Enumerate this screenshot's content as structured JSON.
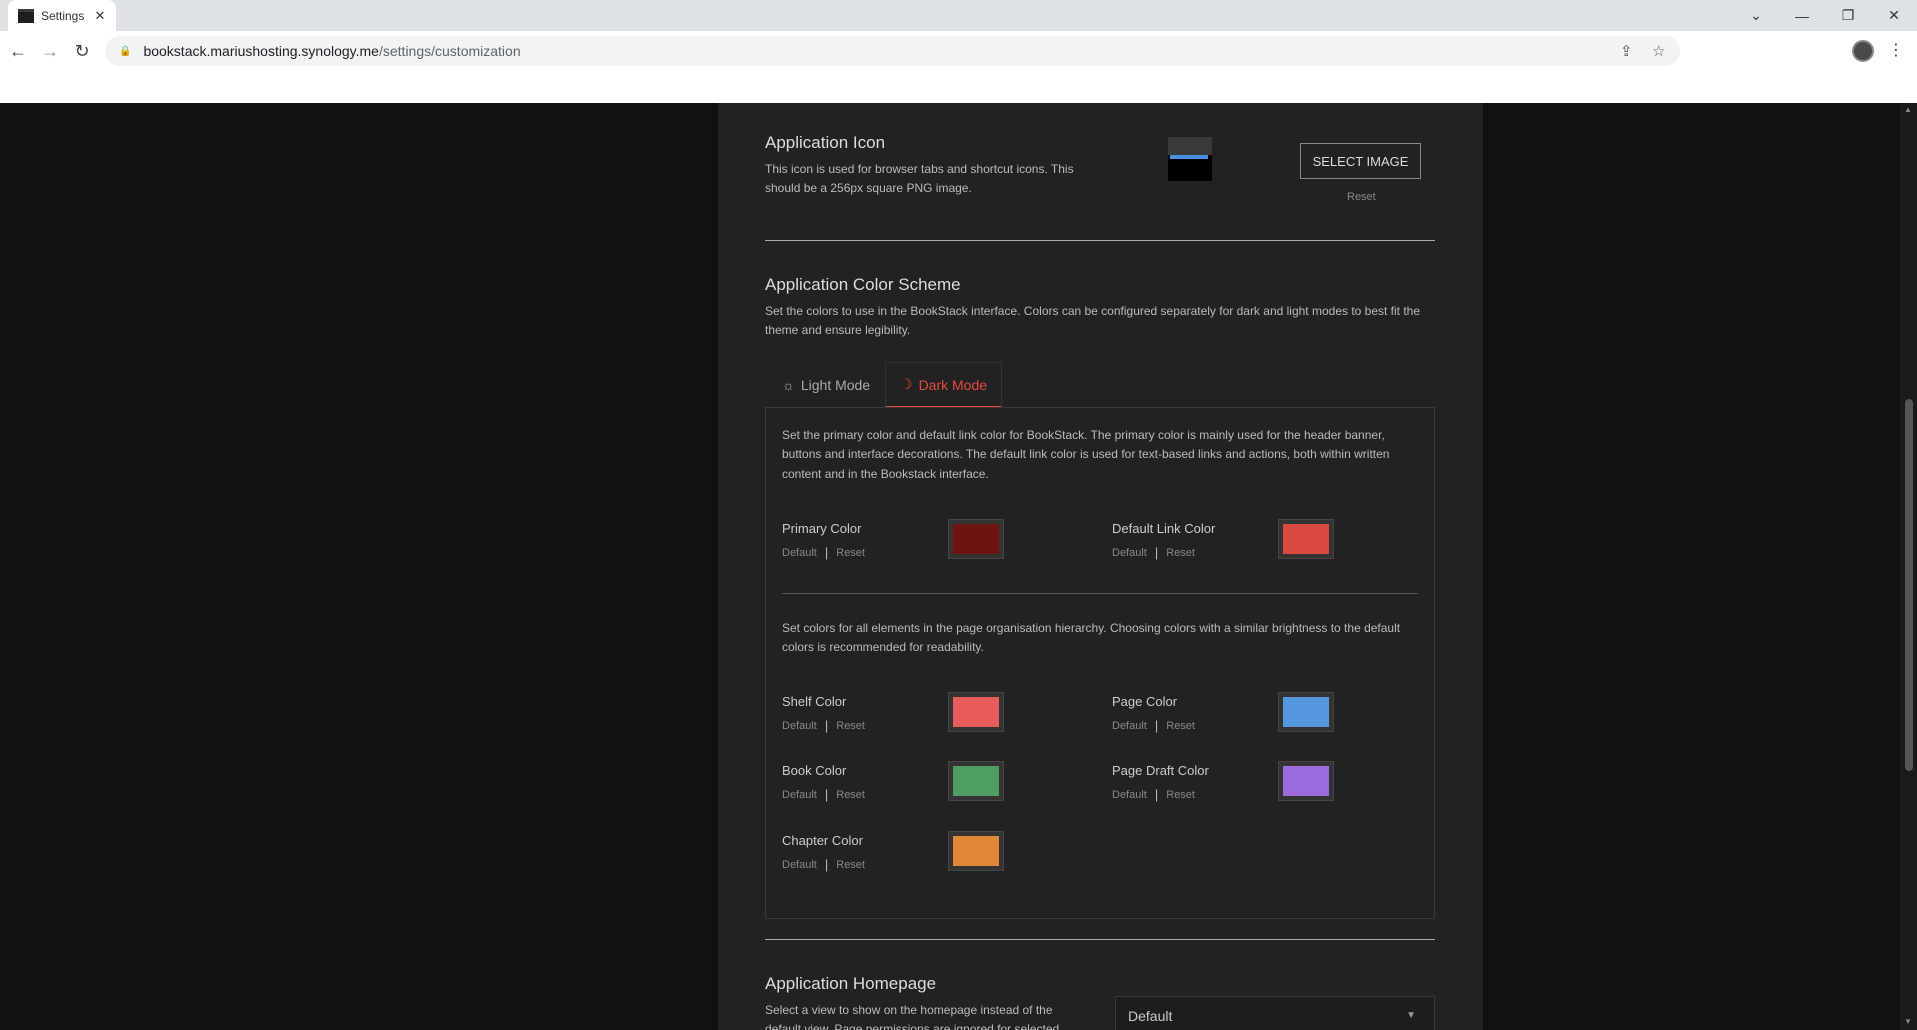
{
  "browser": {
    "tab_title": "Settings",
    "url_host": "bookstack.mariushosting.synology.me",
    "url_path": "/settings/customization"
  },
  "app_icon": {
    "heading": "Application Icon",
    "description_line1": "This icon is used for browser tabs and shortcut icons. This",
    "description_line2": "should be a 256px square PNG image.",
    "select_label": "SELECT IMAGE",
    "reset_label": "Reset"
  },
  "color_scheme": {
    "heading": "Application Color Scheme",
    "description_line1": "Set the colors to use in the BookStack interface. Colors can be configured separately for dark and light modes to best fit the",
    "description_line2": "theme and ensure legibility.",
    "tabs": [
      {
        "label": "Light Mode",
        "icon": "sun-icon"
      },
      {
        "label": "Dark Mode",
        "icon": "moon-icon"
      }
    ],
    "primary_desc_line1": "Set the primary color and default link color for BookStack. The primary color is mainly used for the header banner,",
    "primary_desc_line2": "buttons and interface decorations. The default link color is used for text-based links and actions, both within written",
    "primary_desc_line3": "content and in the Bookstack interface.",
    "hierarchy_desc_line1": "Set colors for all elements in the page organisation hierarchy. Choosing colors with a similar brightness to the default",
    "hierarchy_desc_line2": "colors is recommended for readability.",
    "default_label": "Default",
    "reset_label": "Reset",
    "colors": {
      "primary": {
        "label": "Primary Color",
        "value": "#6d1410"
      },
      "link": {
        "label": "Default Link Color",
        "value": "#d9493f"
      },
      "shelf": {
        "label": "Shelf Color",
        "value": "#e85b5b"
      },
      "page": {
        "label": "Page Color",
        "value": "#5598e0"
      },
      "book": {
        "label": "Book Color",
        "value": "#4e9e64"
      },
      "draft": {
        "label": "Page Draft Color",
        "value": "#9c6bdd"
      },
      "chapter": {
        "label": "Chapter Color",
        "value": "#e08838"
      }
    }
  },
  "homepage": {
    "heading": "Application Homepage",
    "description_line1": "Select a view to show on the homepage instead of the",
    "description_line2": "default view. Page permissions are ignored for selected",
    "selected_value": "Default"
  }
}
